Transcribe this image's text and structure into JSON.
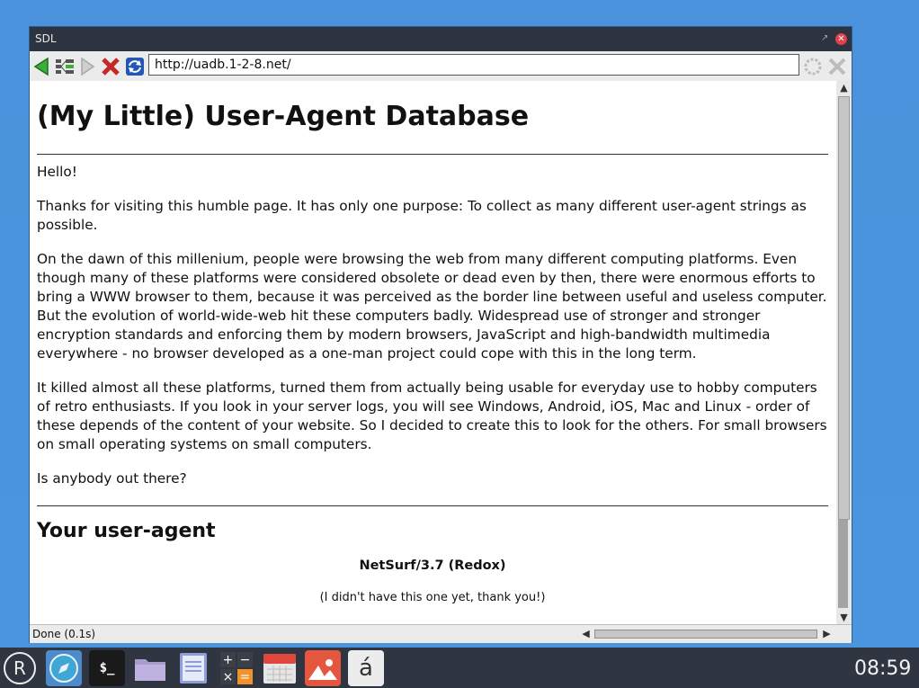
{
  "window": {
    "title": "SDL"
  },
  "toolbar": {
    "back_icon": "back-arrow-icon",
    "history_icon": "history-tree-icon",
    "forward_icon": "forward-arrow-icon",
    "stop_icon": "stop-x-icon",
    "reload_icon": "reload-icon",
    "url": "http://uadb.1-2-8.net/",
    "throbber_icon": "throbber-icon",
    "close_tab_icon": "close-icon"
  },
  "page": {
    "heading": "(My Little) User-Agent Database",
    "paragraphs": [
      "Hello!",
      "Thanks for visiting this humble page. It has only one purpose: To collect as many different user-agent strings as possible.",
      "On the dawn of this millenium, people were browsing the web from many different computing platforms. Even though many of these platforms were considered obsolete or dead even by then, there were enormous efforts to bring a WWW browser to them, because it was perceived as the border line between useful and useless computer. But the evolution of world-wide-web hit these computers badly. Widespread use of stronger and stronger encryption standards and enforcing them by modern browsers, JavaScript and high-bandwidth multimedia everywhere - no browser developed as a one-man project could cope with this in the long term.",
      "It killed almost all these platforms, turned them from actually being usable for everyday use to hobby computers of retro enthusiasts. If you look in your server logs, you will see Windows, Android, iOS, Mac and Linux - order of these depends of the content of your website. So I decided to create this to look for the others. For small browsers on small operating systems on small computers.",
      "Is anybody out there?"
    ],
    "subheading": "Your user-agent",
    "user_agent": "NetSurf/3.7 (Redox)",
    "ua_note": "(I didn't have this one yet, thank you!)"
  },
  "status": {
    "text": "Done (0.1s)"
  },
  "taskbar": {
    "items": [
      "redox-logo-icon",
      "browser-icon",
      "terminal-icon",
      "files-icon",
      "text-editor-icon",
      "calculator-icon",
      "calendar-icon",
      "image-viewer-icon",
      "character-map-icon"
    ],
    "terminal_label": "$_",
    "charmap_label": "á",
    "clock": "08:59"
  },
  "colors": {
    "desktop": "#4a95dd",
    "taskbar": "#2f3541",
    "titlebar": "#2d3440",
    "close": "#e2414b"
  }
}
